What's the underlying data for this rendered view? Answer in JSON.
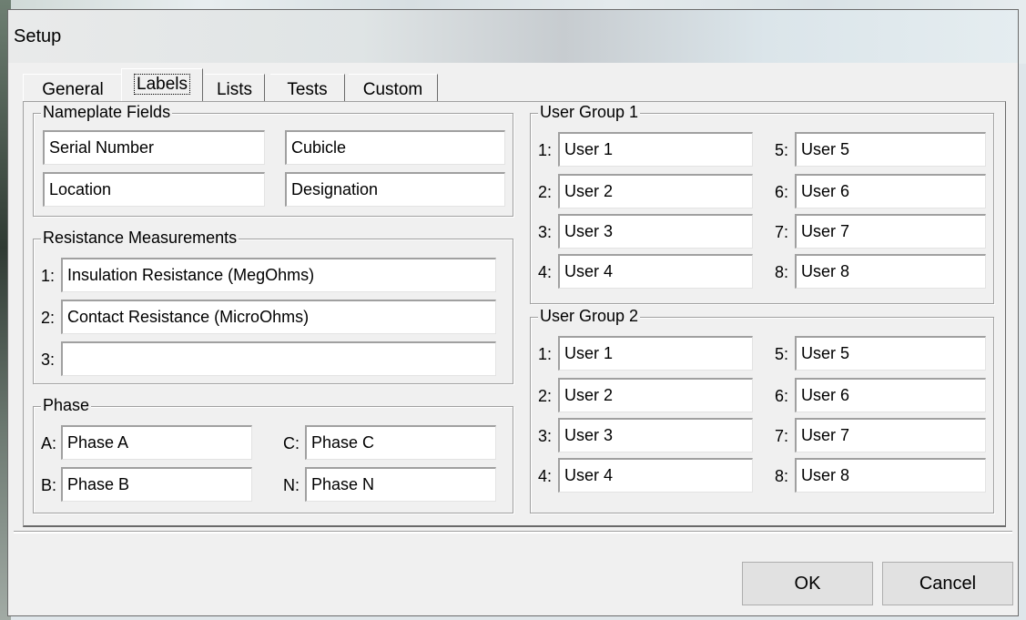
{
  "window": {
    "title": "Setup"
  },
  "tabs": [
    "General",
    "Labels",
    "Lists",
    "Tests",
    "Custom"
  ],
  "nameplate": {
    "title": "Nameplate Fields",
    "fields": [
      "Serial Number",
      "Cubicle",
      "Location",
      "Designation"
    ]
  },
  "resistance": {
    "title": "Resistance Measurements",
    "prefixes": [
      "1:",
      "2:",
      "3:"
    ],
    "values": [
      "Insulation Resistance (MegOhms)",
      "Contact Resistance (MicroOhms)",
      ""
    ]
  },
  "phase": {
    "title": "Phase",
    "prefixes": [
      "A:",
      "B:",
      "C:",
      "N:"
    ],
    "values": [
      "Phase A",
      "Phase B",
      "Phase C",
      "Phase N"
    ]
  },
  "user_group_1": {
    "title": "User Group 1",
    "prefixes": [
      "1:",
      "2:",
      "3:",
      "4:",
      "5:",
      "6:",
      "7:",
      "8:"
    ],
    "values": [
      "User 1",
      "User 2",
      "User 3",
      "User 4",
      "User 5",
      "User 6",
      "User 7",
      "User 8"
    ]
  },
  "user_group_2": {
    "title": "User Group 2",
    "prefixes": [
      "1:",
      "2:",
      "3:",
      "4:",
      "5:",
      "6:",
      "7:",
      "8:"
    ],
    "values": [
      "User 1",
      "User 2",
      "User 3",
      "User 4",
      "User 5",
      "User 6",
      "User 7",
      "User 8"
    ]
  },
  "buttons": {
    "ok": "OK",
    "cancel": "Cancel"
  }
}
